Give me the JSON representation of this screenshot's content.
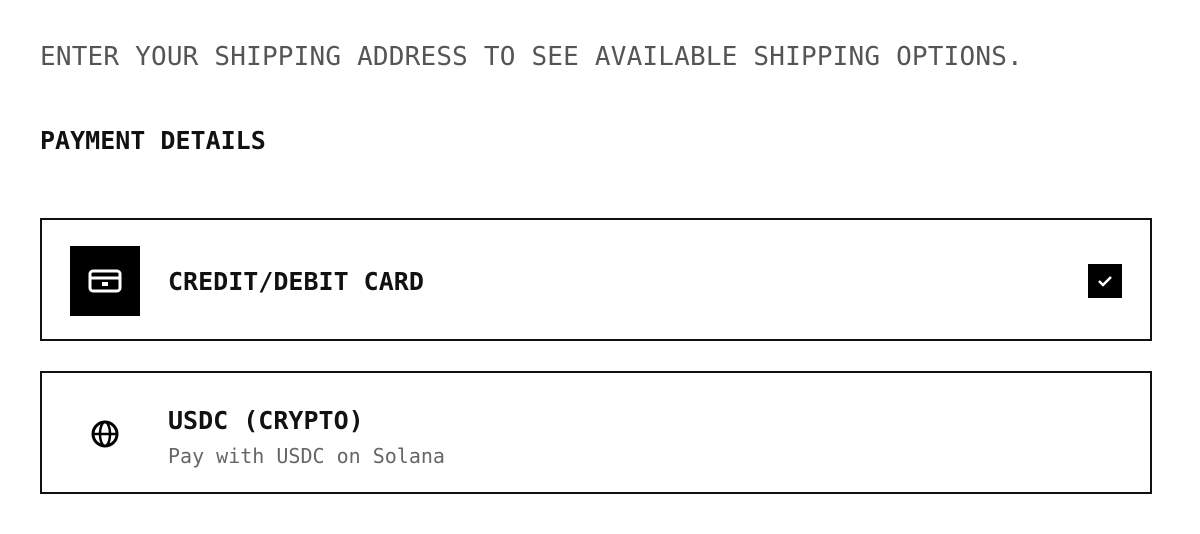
{
  "shipping": {
    "notice": "ENTER YOUR SHIPPING ADDRESS TO SEE AVAILABLE SHIPPING OPTIONS."
  },
  "payment": {
    "section_title": "PAYMENT DETAILS",
    "options": [
      {
        "title": "CREDIT/DEBIT CARD",
        "icon": "credit-card-icon",
        "selected": true
      },
      {
        "title": "USDC (CRYPTO)",
        "subtitle": "Pay with USDC on Solana",
        "icon": "globe-icon",
        "selected": false
      }
    ]
  },
  "colors": {
    "text": "#111111",
    "muted": "#555555",
    "border": "#111111",
    "accent": "#000000"
  }
}
